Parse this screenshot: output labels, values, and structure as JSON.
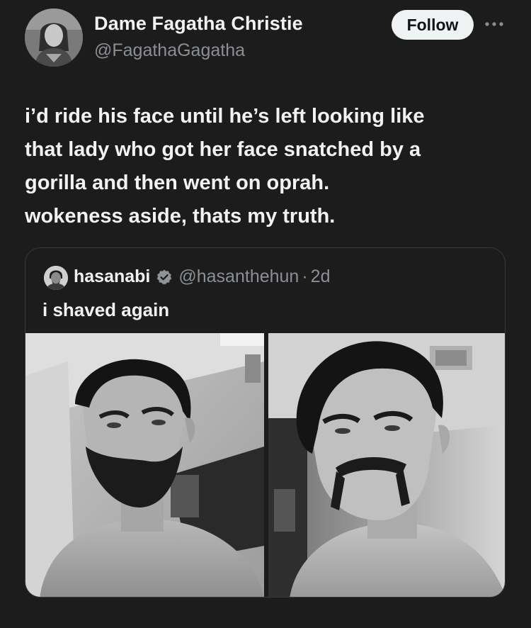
{
  "author": {
    "display_name": "Dame Fagatha Christie",
    "handle": "@FagathaGagatha"
  },
  "actions": {
    "follow_label": "Follow",
    "more_icon": "more-horizontal-icon"
  },
  "tweet": {
    "lines": [
      "i’d ride his face until he’s left looking like",
      "that lady who got her face snatched by a",
      "gorilla and then went on oprah.",
      "wokeness aside, thats my truth."
    ]
  },
  "quoted_tweet": {
    "name": "hasanabi",
    "verified_icon": "verified-badge-icon",
    "handle": "@hasanthehun",
    "separator": "·",
    "time": "2d",
    "text": "i shaved again",
    "photos": [
      "bearded-selfie",
      "mustache-selfie"
    ]
  },
  "colors": {
    "background": "#1c1c1d",
    "text_primary": "#f2f2f2",
    "text_secondary": "#8b8f93",
    "button_bg": "#eff3f4",
    "card_border": "#38393b"
  }
}
